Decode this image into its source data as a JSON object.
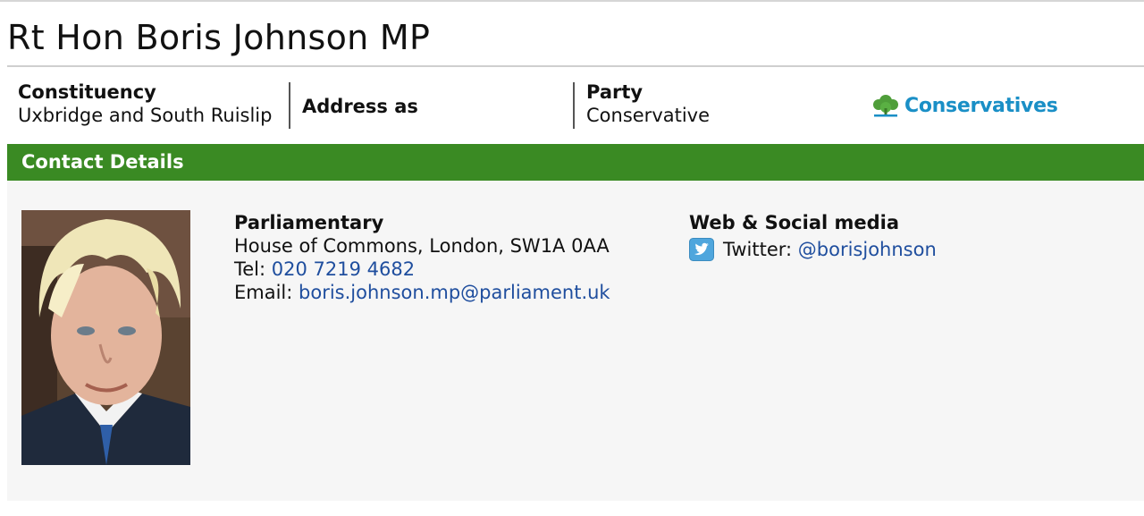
{
  "page": {
    "title": "Rt Hon Boris Johnson MP"
  },
  "info": {
    "constituency_label": "Constituency",
    "constituency_value": "Uxbridge and South Ruislip",
    "address_label": "Address as",
    "party_label": "Party",
    "party_value": "Conservative",
    "party_logo_text": "Conservatives"
  },
  "contact": {
    "section_title": "Contact Details",
    "parliamentary": {
      "heading": "Parliamentary",
      "address": "House of Commons, London, SW1A 0AA",
      "tel_label": "Tel:",
      "tel_value": "020 7219 4682",
      "email_label": "Email:",
      "email_value": "boris.johnson.mp@parliament.uk"
    },
    "social": {
      "heading": "Web & Social media",
      "twitter_label": "Twitter:",
      "twitter_handle": "@borisjohnson"
    }
  },
  "colors": {
    "section_green": "#3a8a23",
    "link_blue": "#1f4e9e",
    "logo_blue": "#1a8fc6",
    "logo_green": "#4f9e3a",
    "twitter_blue": "#4fa6dd"
  },
  "icons": [
    "conservative-tree-icon",
    "twitter-icon"
  ]
}
